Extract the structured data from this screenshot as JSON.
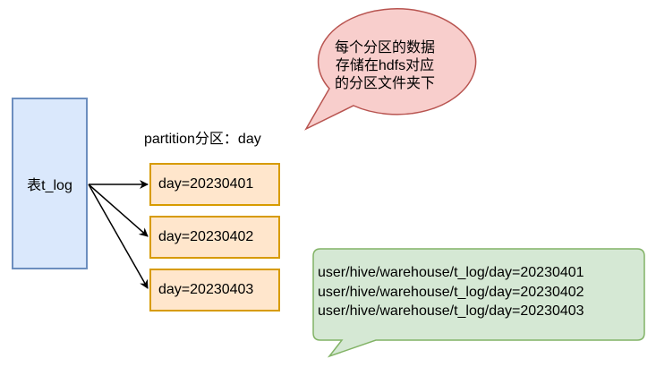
{
  "table": {
    "label": "表t_log"
  },
  "partition_caption": "partition分区：day",
  "partitions": [
    "day=20230401",
    "day=20230402",
    "day=20230403"
  ],
  "red_callout": {
    "lines": [
      "每个分区的数据",
      "存储在hdfs对应",
      "的分区文件夹下"
    ]
  },
  "green_callout": {
    "paths": [
      "user/hive/warehouse/t_log/day=20230401",
      "user/hive/warehouse/t_log/day=20230402",
      "user/hive/warehouse/t_log/day=20230403"
    ]
  },
  "colors": {
    "table_fill": "#dae8fc",
    "table_stroke": "#6c8ebf",
    "partition_fill": "#ffe6cc",
    "partition_stroke": "#d79b00",
    "red_fill": "#f8cecc",
    "red_stroke": "#b85450",
    "green_fill": "#d5e8d4",
    "green_stroke": "#82b366"
  }
}
